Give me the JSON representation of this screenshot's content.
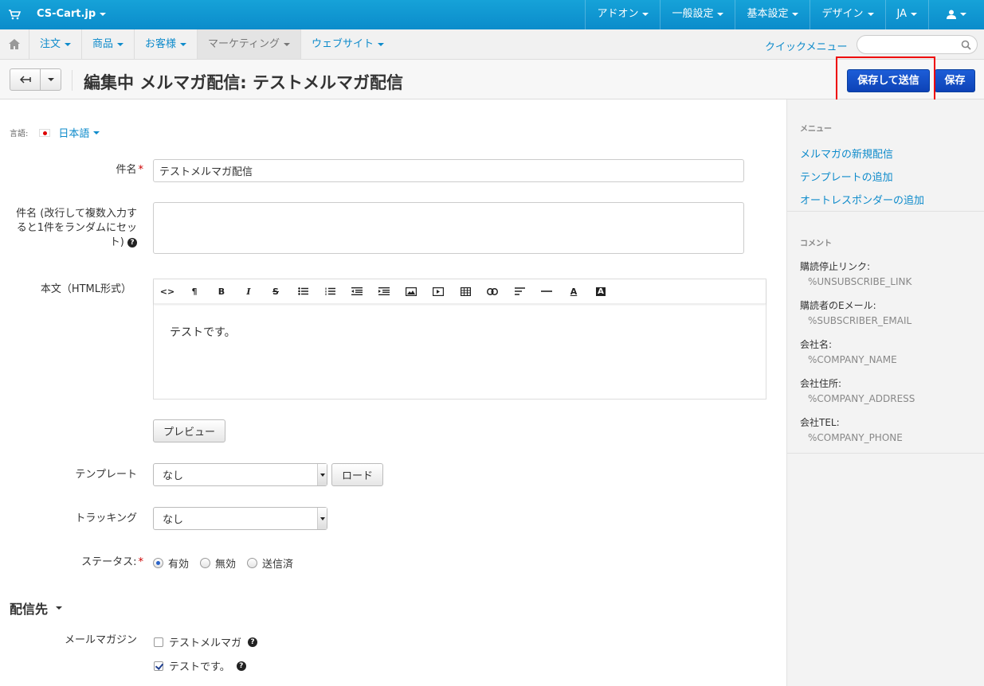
{
  "topbar": {
    "brand": "CS-Cart.jp",
    "menu": [
      "アドオン",
      "一般設定",
      "基本設定",
      "デザイン",
      "JA"
    ]
  },
  "navbar": {
    "items": [
      "注文",
      "商品",
      "お客様",
      "マーケティング",
      "ウェブサイト"
    ],
    "active_index": 3,
    "quick_menu": "クイックメニュー",
    "search_placeholder": ""
  },
  "titlebar": {
    "title": "編集中 メルマガ配信: テストメルマガ配信",
    "send_label": "保存して送信",
    "save_label": "保存"
  },
  "form": {
    "language_label": "言語:",
    "language_value": "日本語",
    "subject_label": "件名",
    "subject_value": "テストメルマガ配信",
    "multi_subject_label_1": "件名 (改行して複数入力す",
    "multi_subject_label_2": "ると1件をランダムにセッ",
    "multi_subject_label_3": "ト)",
    "body_label": "本文（HTML形式）",
    "body_text": "テストです。",
    "preview_label": "プレビュー",
    "template_label": "テンプレート",
    "template_value": "なし",
    "load_label": "ロード",
    "tracking_label": "トラッキング",
    "tracking_value": "なし",
    "status_label": "ステータス:",
    "status_options": [
      "有効",
      "無効",
      "送信済"
    ],
    "status_selected": 0
  },
  "recipients": {
    "heading": "配信先",
    "mailing_lists_label": "メールマガジン",
    "lists": [
      {
        "label": "テストメルマガ",
        "checked": false
      },
      {
        "label": "テストです。",
        "checked": true
      }
    ]
  },
  "sidebar": {
    "menu_heading": "メニュー",
    "menu_links": [
      "メルマガの新規配信",
      "テンプレートの追加",
      "オートレスポンダーの追加"
    ],
    "comment_heading": "コメント",
    "placeholders": [
      {
        "key": "購読停止リンク:",
        "value": "%UNSUBSCRIBE_LINK"
      },
      {
        "key": "購読者のEメール:",
        "value": "%SUBSCRIBER_EMAIL"
      },
      {
        "key": "会社名:",
        "value": "%COMPANY_NAME"
      },
      {
        "key": "会社住所:",
        "value": "%COMPANY_ADDRESS"
      },
      {
        "key": "会社TEL:",
        "value": "%COMPANY_PHONE"
      }
    ]
  },
  "colors": {
    "accent": "#0e8bcb",
    "primary_button": "#0d42b6",
    "highlight": "#ee0000"
  }
}
